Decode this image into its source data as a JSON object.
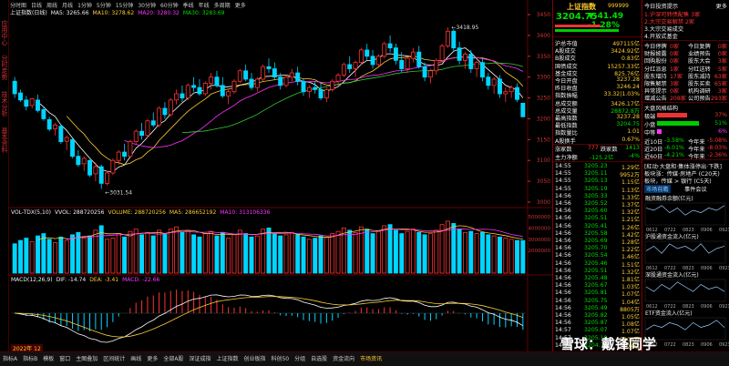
{
  "top_tabs": [
    "分时图",
    "日线",
    "周线",
    "月线",
    "1分钟",
    "5分钟",
    "15分钟",
    "30分钟",
    "60分钟",
    "季线",
    "年线",
    "多周期",
    "更多"
  ],
  "kline_info": {
    "title": "上证指数(日线)",
    "ma5": "MA5: 3265.66",
    "ma10": "MA10: 3278.62",
    "ma20": "MA20: 3280.32",
    "ma30": "MA30: 3283.69"
  },
  "price_axis": [
    "3450",
    "3400",
    "3350",
    "3300",
    "3250",
    "3200",
    "3150",
    "3100",
    "3050",
    "3000"
  ],
  "high_marker": "3418.95",
  "low_marker": "3031.54",
  "vol_info": {
    "title": "VOL-TDX(5,10)",
    "vvol": "VVOL: 288720256",
    "volume": "VOLUME: 288720256",
    "ma5": "MA5: 286652192",
    "ma10": "MA10: 313106336"
  },
  "vol_axis": [
    "5000000",
    "4000000",
    "3000000",
    "2000000"
  ],
  "macd_info": {
    "title": "MACD(12,26,9)",
    "dif": "DIF: -14.74",
    "dea": "DEA: -3.41",
    "macd": "MACD: -22.66"
  },
  "date_tag": "2022年 12",
  "bottom_tabs": [
    "指标A",
    "指标B",
    "模板",
    "窗口",
    "主图叠加",
    "区间统计",
    "画线",
    "更多",
    "全部A股",
    "深证成指",
    "上证指数",
    "创业板指",
    "科创50",
    "分组",
    "自选股",
    "资金流向",
    "市场资讯"
  ],
  "quote": {
    "name": "上证指数",
    "code": "999999",
    "price": "3204.75",
    "change": "▼-41.49 -1.28%",
    "stats": [
      {
        "label": "沪总市值",
        "value": "497115亿"
      },
      {
        "label": "A股成交",
        "value": "3424.92亿"
      },
      {
        "label": "B股成交",
        "value": "0.83亿"
      },
      {
        "label": "国债成交",
        "value": "15257.33亿"
      },
      {
        "label": "基金成交",
        "value": "825.76亿"
      },
      {
        "label": "今日开盘",
        "value": "3237.28"
      },
      {
        "label": "昨日收盘",
        "value": "3246.24"
      },
      {
        "label": "指数振幅",
        "value": "33.32|1.03%"
      },
      {
        "label": "总成交额",
        "value": "3426.17亿"
      },
      {
        "label": "总成交量",
        "value": "28872.8万"
      },
      {
        "label": "最高指数",
        "value": "3237.28"
      },
      {
        "label": "最低指数",
        "value": "3204.75"
      },
      {
        "label": "指数量比",
        "value": "1.01"
      },
      {
        "label": "A股换手",
        "value": "0.67%"
      }
    ],
    "up_label": "涨家数",
    "up_value": "777",
    "down_label": "跌家数",
    "down_value": "1413",
    "flow_label": "主力净额",
    "flow_value": "-125.2亿",
    "flow_pct": "-4%"
  },
  "ticks": [
    [
      "14:55",
      "3205.23",
      "1.29亿"
    ],
    [
      "14:55",
      "3205.11",
      "9952万"
    ],
    [
      "14:55",
      "3205.13",
      "1.15亿"
    ],
    [
      "14:55",
      "3205.19",
      "1.13亿"
    ],
    [
      "14:56",
      "3205.33",
      "1.33亿"
    ],
    [
      "14:56",
      "3205.52",
      "1.37亿"
    ],
    [
      "14:56",
      "3205.60",
      "1.32亿"
    ],
    [
      "14:56",
      "3205.51",
      "1.21亿"
    ],
    [
      "14:56",
      "3205.41",
      "1.26亿"
    ],
    [
      "14:56",
      "3205.58",
      "1.42亿"
    ],
    [
      "14:56",
      "3205.69",
      "1.28亿"
    ],
    [
      "14:56",
      "3205.70",
      "1.22亿"
    ],
    [
      "14:56",
      "3205.54",
      "1.46亿"
    ],
    [
      "14:56",
      "3205.46",
      "1.51亿"
    ],
    [
      "14:56",
      "3205.51",
      "1.32亿"
    ],
    [
      "14:56",
      "3205.48",
      "1.81亿"
    ],
    [
      "14:56",
      "3205.67",
      "1.03亿"
    ],
    [
      "14:56",
      "3205.81",
      "1.07亿"
    ],
    [
      "14:56",
      "3205.75",
      "1.04亿"
    ],
    [
      "14:56",
      "3205.49",
      "8805万"
    ],
    [
      "14:56",
      "3205.82",
      "1.05亿"
    ],
    [
      "14:56",
      "3205.87",
      "1.08亿"
    ],
    [
      "14:57",
      "3205.07",
      "1.07亿"
    ],
    [
      "14:57",
      "3205.18",
      "5204万"
    ],
    [
      "14:57",
      "3204.75",
      "5.26亿"
    ]
  ],
  "far": {
    "title": "今日投资提示",
    "more": "更多",
    "tips": [
      "1.沪深可转债配售 3家",
      "2.大宗交易解禁 2家",
      "3.大宗交易成交",
      "4.开放式基金"
    ],
    "grid": [
      [
        "今日停牌",
        "0家",
        "今日复牌",
        "0家"
      ],
      [
        "财报披露",
        "0家",
        "业绩预告",
        "0家"
      ],
      [
        "回购股份",
        "0家",
        "股东大会",
        "3家"
      ],
      [
        "分红派息",
        "1家",
        "分红送转",
        "5家"
      ],
      [
        "股东增持",
        "17家",
        "股东减持",
        "63家"
      ],
      [
        "限售解禁",
        "3家",
        "股东买卖",
        "65家"
      ],
      [
        "异常提示",
        "0家",
        "机构调研",
        "3家"
      ],
      [
        "增减公告",
        "208家",
        "公司预告",
        "293家"
      ]
    ],
    "section2": "大盘风格结构",
    "bars": [
      {
        "label": "极端",
        "pct": "37%",
        "color": "#e33"
      },
      {
        "label": "小盘",
        "pct": "51%",
        "color": "#0c0"
      },
      {
        "label": "中等",
        "pct": "6%",
        "color": "#f3f"
      }
    ],
    "perf": [
      [
        "近10日",
        "-3.58%",
        "今年来",
        "-5.08%"
      ],
      [
        "近20日",
        "-6.01%",
        "今年来",
        "-8.03%"
      ],
      [
        "近60日",
        "-4.21%",
        "今年来",
        "-2.36%"
      ]
    ],
    "news": [
      "[紅动·大盘和·集体涨停出·下跌]",
      "板块涨：传媒·房地产 (C20天)",
      "板块，传媒 > 银行 (C5天)"
    ],
    "tabs": [
      "市场前瞻",
      "事件会议"
    ],
    "mini_titles": [
      "融资融券余额(亿元)",
      "沪股通资金流入(亿元)",
      "深股通资金流入(亿元)",
      "ETF资金流入(亿元)"
    ],
    "mini_x": [
      "0612",
      "0722",
      "0823",
      "0906",
      "0923"
    ]
  },
  "watermark": "雪球：戴锋同学",
  "colors": {
    "up": "#ff3333",
    "down": "#00d5ff",
    "ma5": "#ffffff",
    "ma10": "#ffcc33",
    "ma20": "#ff33ff",
    "ma30": "#33cc33"
  },
  "chart_data": {
    "type": "candlestick",
    "title": "上证指数(日线)",
    "ylim": [
      3000,
      3450
    ],
    "highlights": {
      "high": 3418.95,
      "low": 3031.54
    },
    "candles": [
      [
        3290,
        3300,
        3250,
        3260
      ],
      [
        3262,
        3270,
        3240,
        3245
      ],
      [
        3245,
        3255,
        3220,
        3230
      ],
      [
        3232,
        3250,
        3225,
        3248
      ],
      [
        3245,
        3258,
        3215,
        3220
      ],
      [
        3222,
        3230,
        3195,
        3200
      ],
      [
        3198,
        3205,
        3170,
        3175
      ],
      [
        3176,
        3190,
        3160,
        3185
      ],
      [
        3182,
        3185,
        3140,
        3145
      ],
      [
        3146,
        3160,
        3125,
        3155
      ],
      [
        3150,
        3152,
        3105,
        3110
      ],
      [
        3110,
        3125,
        3085,
        3090
      ],
      [
        3092,
        3110,
        3075,
        3105
      ],
      [
        3100,
        3102,
        3060,
        3065
      ],
      [
        3068,
        3095,
        3050,
        3085
      ],
      [
        3085,
        3090,
        3031.54,
        3045
      ],
      [
        3045,
        3075,
        3040,
        3070
      ],
      [
        3070,
        3105,
        3065,
        3100
      ],
      [
        3100,
        3125,
        3090,
        3120
      ],
      [
        3120,
        3140,
        3100,
        3110
      ],
      [
        3110,
        3150,
        3105,
        3145
      ],
      [
        3145,
        3175,
        3140,
        3170
      ],
      [
        3170,
        3190,
        3150,
        3160
      ],
      [
        3160,
        3200,
        3155,
        3195
      ],
      [
        3195,
        3215,
        3180,
        3185
      ],
      [
        3185,
        3230,
        3180,
        3225
      ],
      [
        3225,
        3240,
        3200,
        3210
      ],
      [
        3210,
        3250,
        3205,
        3245
      ],
      [
        3245,
        3270,
        3235,
        3260
      ],
      [
        3260,
        3280,
        3240,
        3250
      ],
      [
        3250,
        3285,
        3245,
        3280
      ],
      [
        3280,
        3300,
        3265,
        3275
      ],
      [
        3275,
        3295,
        3255,
        3260
      ],
      [
        3260,
        3290,
        3255,
        3285
      ],
      [
        3285,
        3310,
        3270,
        3300
      ],
      [
        3300,
        3315,
        3275,
        3280
      ],
      [
        3280,
        3300,
        3250,
        3255
      ],
      [
        3255,
        3270,
        3235,
        3265
      ],
      [
        3265,
        3295,
        3260,
        3290
      ],
      [
        3290,
        3320,
        3285,
        3315
      ],
      [
        3315,
        3330,
        3290,
        3295
      ],
      [
        3295,
        3310,
        3270,
        3275
      ],
      [
        3275,
        3300,
        3265,
        3295
      ],
      [
        3295,
        3330,
        3290,
        3325
      ],
      [
        3325,
        3345,
        3310,
        3320
      ],
      [
        3320,
        3335,
        3295,
        3300
      ],
      [
        3300,
        3310,
        3270,
        3280
      ],
      [
        3280,
        3305,
        3275,
        3300
      ],
      [
        3300,
        3320,
        3290,
        3310
      ],
      [
        3310,
        3325,
        3280,
        3290
      ],
      [
        3290,
        3295,
        3255,
        3265
      ],
      [
        3265,
        3280,
        3250,
        3275
      ],
      [
        3275,
        3290,
        3260,
        3270
      ],
      [
        3270,
        3285,
        3245,
        3250
      ],
      [
        3250,
        3275,
        3240,
        3270
      ],
      [
        3270,
        3295,
        3265,
        3290
      ],
      [
        3290,
        3310,
        3280,
        3305
      ],
      [
        3305,
        3335,
        3300,
        3330
      ],
      [
        3330,
        3350,
        3310,
        3320
      ],
      [
        3320,
        3340,
        3300,
        3335
      ],
      [
        3335,
        3370,
        3330,
        3365
      ],
      [
        3365,
        3380,
        3340,
        3350
      ],
      [
        3350,
        3365,
        3320,
        3330
      ],
      [
        3330,
        3355,
        3325,
        3350
      ],
      [
        3350,
        3385,
        3345,
        3380
      ],
      [
        3380,
        3400,
        3360,
        3370
      ],
      [
        3370,
        3380,
        3330,
        3340
      ],
      [
        3340,
        3360,
        3310,
        3320
      ],
      [
        3320,
        3350,
        3310,
        3345
      ],
      [
        3345,
        3370,
        3335,
        3360
      ],
      [
        3360,
        3375,
        3320,
        3325
      ],
      [
        3325,
        3335,
        3290,
        3300
      ],
      [
        3300,
        3320,
        3285,
        3315
      ],
      [
        3315,
        3345,
        3305,
        3340
      ],
      [
        3340,
        3380,
        3335,
        3375
      ],
      [
        3375,
        3418.95,
        3370,
        3410
      ],
      [
        3410,
        3415,
        3360,
        3370
      ],
      [
        3370,
        3385,
        3330,
        3340
      ],
      [
        3340,
        3360,
        3320,
        3355
      ],
      [
        3355,
        3365,
        3310,
        3320
      ],
      [
        3320,
        3340,
        3300,
        3335
      ],
      [
        3335,
        3345,
        3290,
        3300
      ],
      [
        3300,
        3310,
        3270,
        3280
      ],
      [
        3280,
        3300,
        3260,
        3295
      ],
      [
        3295,
        3305,
        3250,
        3260
      ],
      [
        3260,
        3275,
        3240,
        3265
      ],
      [
        3265,
        3280,
        3250,
        3275
      ],
      [
        3275,
        3285,
        3240,
        3246.24
      ],
      [
        3237.28,
        3237.28,
        3203.96,
        3204.75
      ]
    ],
    "volume": [
      2600,
      2900,
      3100,
      2800,
      3300,
      3500,
      3000,
      2700,
      3200,
      2900,
      3400,
      3600,
      3100,
      3300,
      3800,
      4200,
      3000,
      3100,
      3500,
      3200,
      3700,
      3900,
      3400,
      3600,
      3300,
      3800,
      3500,
      3900,
      4100,
      3600,
      3800,
      3400,
      3200,
      3500,
      3700,
      3300,
      3600,
      3100,
      3400,
      3800,
      3500,
      3200,
      3300,
      3900,
      4000,
      3500,
      3300,
      3400,
      3600,
      3400,
      3200,
      3000,
      3100,
      3300,
      3200,
      3500,
      3700,
      4000,
      3800,
      3600,
      4100,
      3900,
      3500,
      3700,
      4200,
      4300,
      3800,
      3500,
      3700,
      3900,
      3600,
      3400,
      3500,
      3800,
      4300,
      4600,
      4400,
      3900,
      3600,
      3700,
      3500,
      3600,
      3400,
      3300,
      3200,
      3100,
      3000,
      2900,
      2887
    ],
    "macd": {
      "dif": [
        -14.74
      ],
      "dea": [
        -3.41
      ],
      "macd": [
        -22.66
      ]
    }
  }
}
